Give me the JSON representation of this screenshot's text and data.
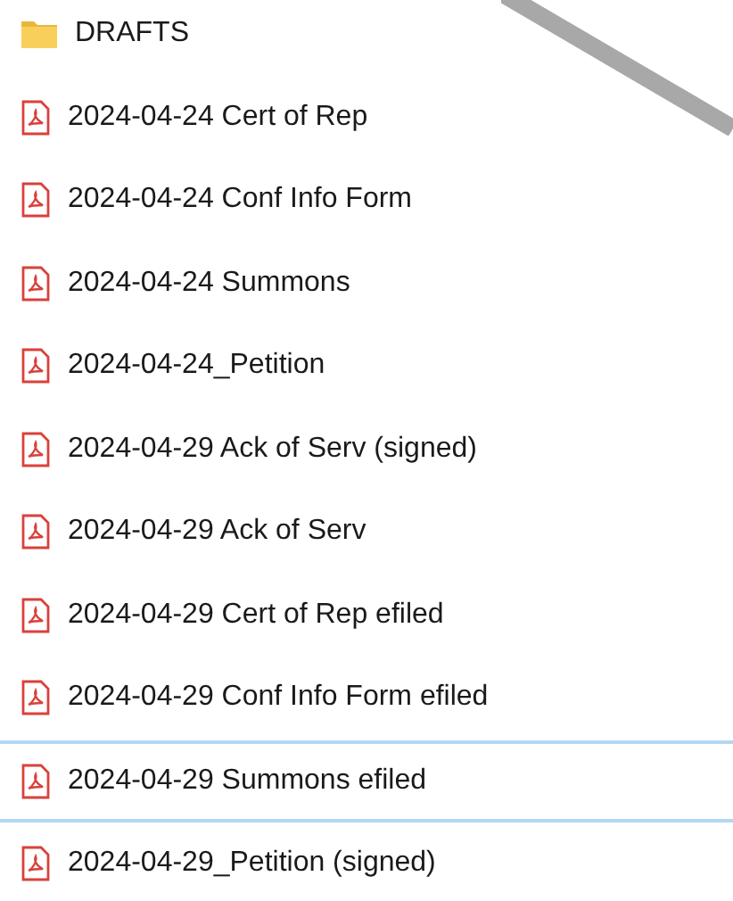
{
  "items": [
    {
      "kind": "folder",
      "name": "DRAFTS",
      "selected": false
    },
    {
      "kind": "pdf",
      "name": "2024-04-24 Cert of Rep",
      "selected": false
    },
    {
      "kind": "pdf",
      "name": "2024-04-24 Conf Info Form",
      "selected": false
    },
    {
      "kind": "pdf",
      "name": "2024-04-24 Summons",
      "selected": false
    },
    {
      "kind": "pdf",
      "name": "2024-04-24_Petition",
      "selected": false
    },
    {
      "kind": "pdf",
      "name": "2024-04-29 Ack of Serv (signed)",
      "selected": false
    },
    {
      "kind": "pdf",
      "name": "2024-04-29 Ack of Serv",
      "selected": false
    },
    {
      "kind": "pdf",
      "name": "2024-04-29 Cert of Rep efiled",
      "selected": false
    },
    {
      "kind": "pdf",
      "name": "2024-04-29 Conf Info Form efiled",
      "selected": false
    },
    {
      "kind": "pdf",
      "name": "2024-04-29 Summons efiled",
      "selected": true
    },
    {
      "kind": "pdf",
      "name": "2024-04-29_Petition (signed)",
      "selected": false
    }
  ]
}
